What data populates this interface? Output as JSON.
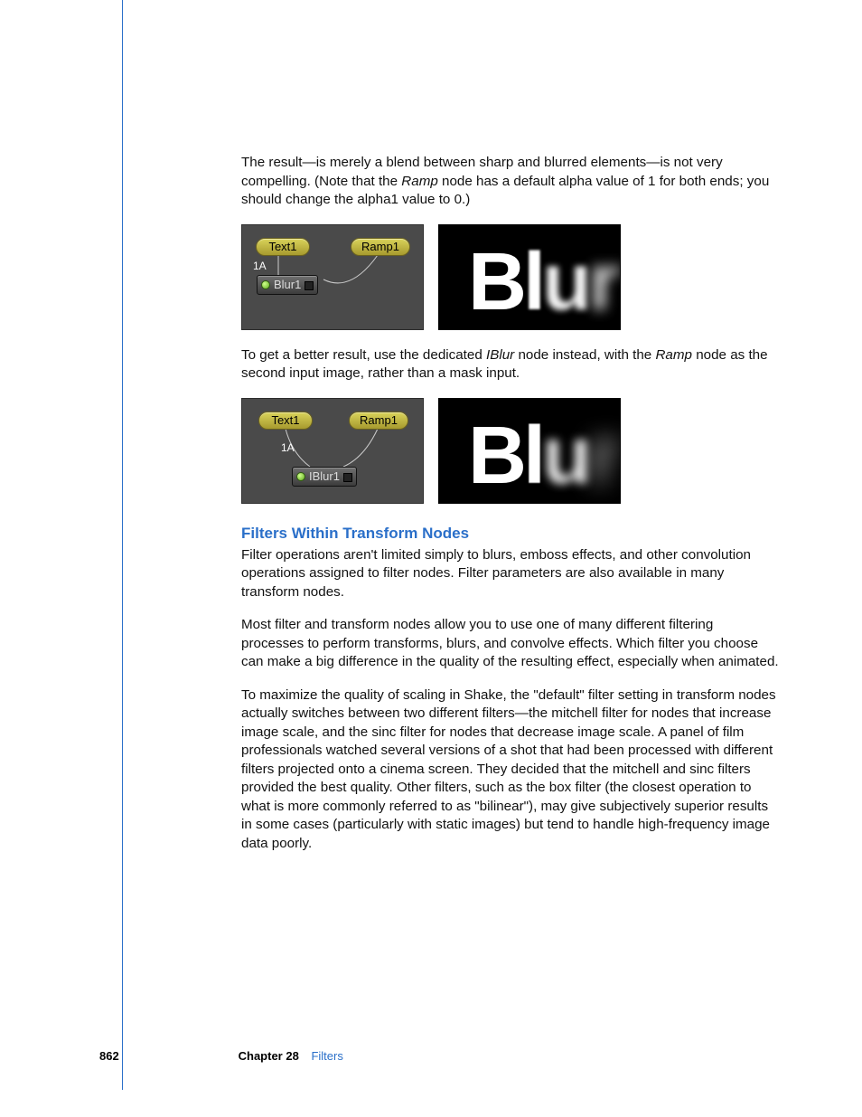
{
  "paragraphs": {
    "p1a": "The result—is merely a blend between sharp and blurred elements—is not very compelling. (Note that the ",
    "p1_ramp": "Ramp",
    "p1b": " node has a default alpha value of 1 for both ends; you should change the alpha1 value to 0.)",
    "p2a": "To get a better result, use the dedicated ",
    "p2_iblur": "IBlur",
    "p2b": " node instead, with the ",
    "p2_ramp": "Ramp",
    "p2c": " node as the second input image, rather than a mask input.",
    "p3": "Filter operations aren't limited simply to blurs, emboss effects, and other convolution operations assigned to filter nodes. Filter parameters are also available in many transform nodes.",
    "p4": "Most filter and transform nodes allow you to use one of many different filtering processes to perform transforms, blurs, and convolve effects. Which filter you choose can make a big difference in the quality of the resulting effect, especially when animated.",
    "p5": "To maximize the quality of scaling in Shake, the \"default\" filter setting in transform nodes actually switches between two different filters—the mitchell filter for nodes that increase image scale, and the sinc filter for nodes that decrease image scale. A panel of film professionals watched several versions of a shot that had been processed with different filters projected onto a cinema screen. They decided that the mitchell and sinc filters provided the best quality. Other filters, such as the box filter (the closest operation to what is more commonly referred to as \"bilinear\"), may give subjectively superior results in some cases (particularly with static images) but tend to handle high-frequency image data poorly."
  },
  "section_heading": "Filters Within Transform Nodes",
  "figures": {
    "fig1": {
      "nodes": {
        "text1": "Text1",
        "ramp1": "Ramp1",
        "blur1": "Blur1"
      },
      "port_label": "1A",
      "preview_word": "Blur"
    },
    "fig2": {
      "nodes": {
        "text1": "Text1",
        "ramp1": "Ramp1",
        "iblur1": "IBlur1"
      },
      "port_label": "1A",
      "preview_word": "Blur"
    }
  },
  "footer": {
    "page_number": "862",
    "chapter_label": "Chapter 28",
    "chapter_name": "Filters"
  }
}
